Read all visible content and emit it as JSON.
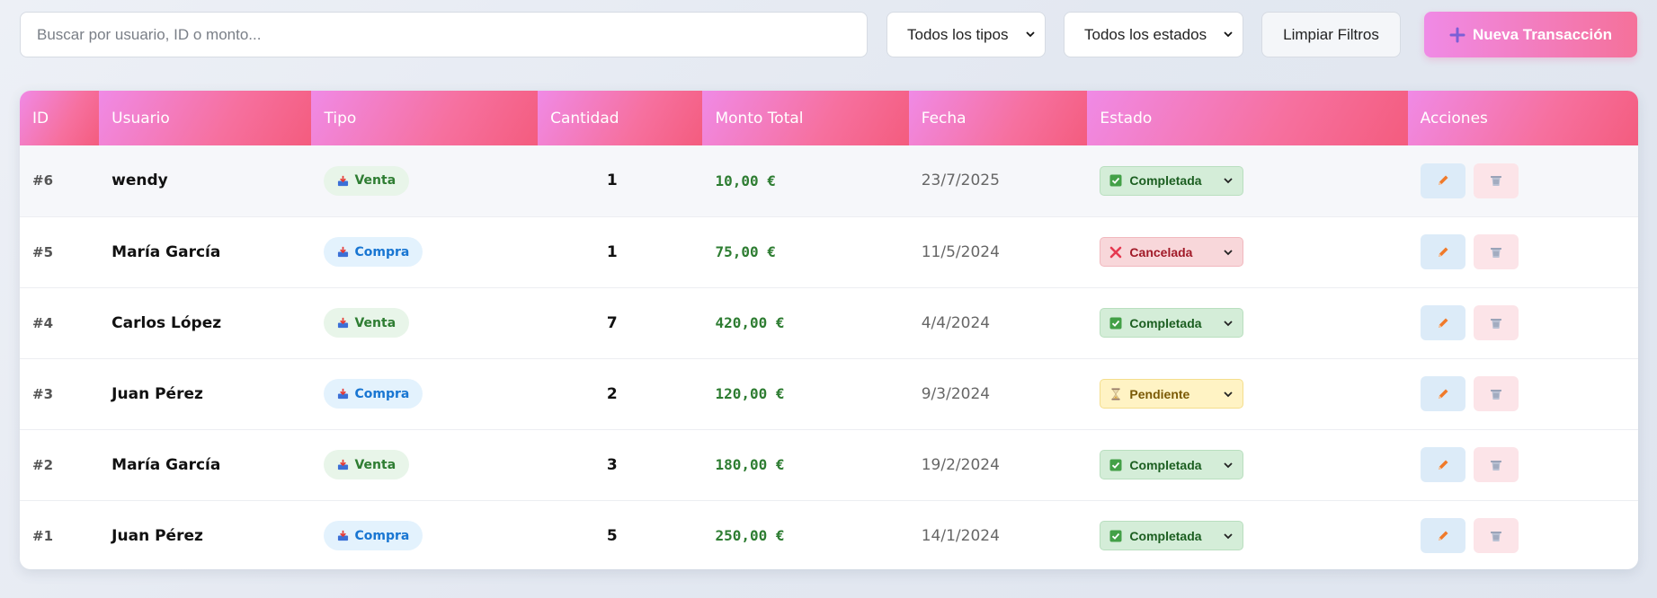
{
  "toolbar": {
    "search_placeholder": "Buscar por usuario, ID o monto...",
    "type_filter": "Todos los tipos",
    "status_filter": "Todos los estados",
    "clear_label": "Limpiar Filtros",
    "new_label": "Nueva Transacción",
    "new_icon": "plus-icon"
  },
  "table": {
    "headers": [
      "ID",
      "Usuario",
      "Tipo",
      "Cantidad",
      "Monto Total",
      "Fecha",
      "Estado",
      "Acciones"
    ],
    "rows": [
      {
        "id": "#6",
        "user": "wendy",
        "type": "Venta",
        "qty": "1",
        "amount": "10,00 €",
        "date": "23/7/2025",
        "status": "Completada"
      },
      {
        "id": "#5",
        "user": "María García",
        "type": "Compra",
        "qty": "1",
        "amount": "75,00 €",
        "date": "11/5/2024",
        "status": "Cancelada"
      },
      {
        "id": "#4",
        "user": "Carlos López",
        "type": "Venta",
        "qty": "7",
        "amount": "420,00 €",
        "date": "4/4/2024",
        "status": "Completada"
      },
      {
        "id": "#3",
        "user": "Juan Pérez",
        "type": "Compra",
        "qty": "2",
        "amount": "120,00 €",
        "date": "9/3/2024",
        "status": "Pendiente"
      },
      {
        "id": "#2",
        "user": "María García",
        "type": "Venta",
        "qty": "3",
        "amount": "180,00 €",
        "date": "19/2/2024",
        "status": "Completada"
      },
      {
        "id": "#1",
        "user": "Juan Pérez",
        "type": "Compra",
        "qty": "5",
        "amount": "250,00 €",
        "date": "14/1/2024",
        "status": "Completada"
      }
    ]
  },
  "icons": {
    "type": "inbox-tray-icon",
    "completada": "check-box-icon",
    "cancelada": "cross-icon",
    "pendiente": "hourglass-icon",
    "edit": "pencil-icon",
    "delete": "trash-icon"
  },
  "colors": {
    "accent_start": "#f08ae6",
    "accent_end": "#f45c7e",
    "amount": "#2e7d32",
    "venta_bg": "#e8f5e9",
    "compra_bg": "#e3f2fd",
    "completada_bg": "#d4edd8",
    "cancelada_bg": "#f8d7da",
    "pendiente_bg": "#fff3c4"
  }
}
